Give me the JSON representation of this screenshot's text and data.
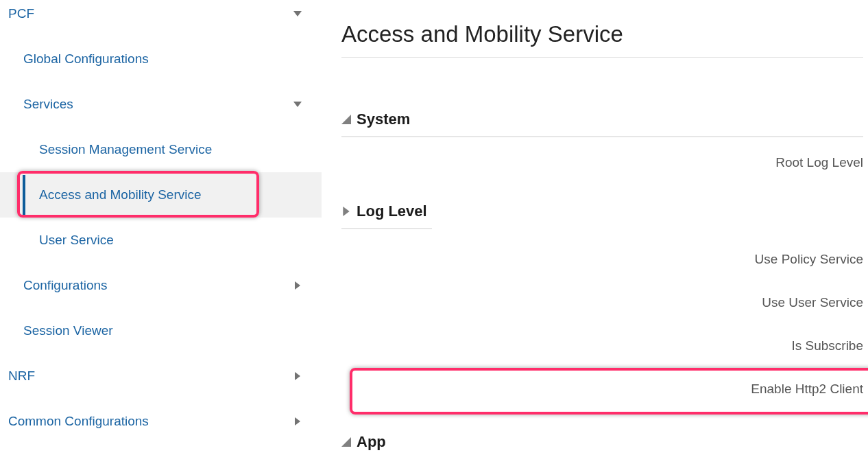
{
  "navigation": [
    {
      "label": "PCF",
      "selected": false,
      "highlighted": false,
      "expanded": true,
      "children": [
        {
          "label": "Global Configurations",
          "selected": false,
          "highlighted": false
        },
        {
          "label": "Services",
          "selected": false,
          "highlighted": false,
          "expanded": true,
          "children": [
            {
              "label": "Session Management Service",
              "selected": false,
              "highlighted": false
            },
            {
              "label": "Access and Mobility Service",
              "selected": true,
              "highlighted": true
            },
            {
              "label": "User Service",
              "selected": false,
              "highlighted": false
            }
          ]
        },
        {
          "label": "Configurations",
          "selected": false,
          "highlighted": false,
          "expanded": false
        },
        {
          "label": "Session Viewer",
          "selected": false,
          "highlighted": false
        }
      ]
    },
    {
      "label": "NRF",
      "selected": false,
      "highlighted": false,
      "expanded": false
    },
    {
      "label": "Common Configurations",
      "selected": false,
      "highlighted": false,
      "expanded": false
    }
  ],
  "page": {
    "title": "Access and Mobility Service",
    "items": [
      {
        "kind": "section",
        "label": "System",
        "expanded": true
      },
      {
        "kind": "field",
        "label": "Root Log Level",
        "highlighted": false
      },
      {
        "kind": "subsection",
        "label": "Log Level",
        "expanded": false
      },
      {
        "kind": "field",
        "label": "Use Policy Service",
        "highlighted": false
      },
      {
        "kind": "field",
        "label": "Use User Service",
        "highlighted": false
      },
      {
        "kind": "field",
        "label": "Is Subscribe",
        "highlighted": false
      },
      {
        "kind": "field",
        "label": "Enable Http2 Client",
        "highlighted": true
      },
      {
        "kind": "section",
        "label": "App",
        "expanded": true
      }
    ]
  }
}
